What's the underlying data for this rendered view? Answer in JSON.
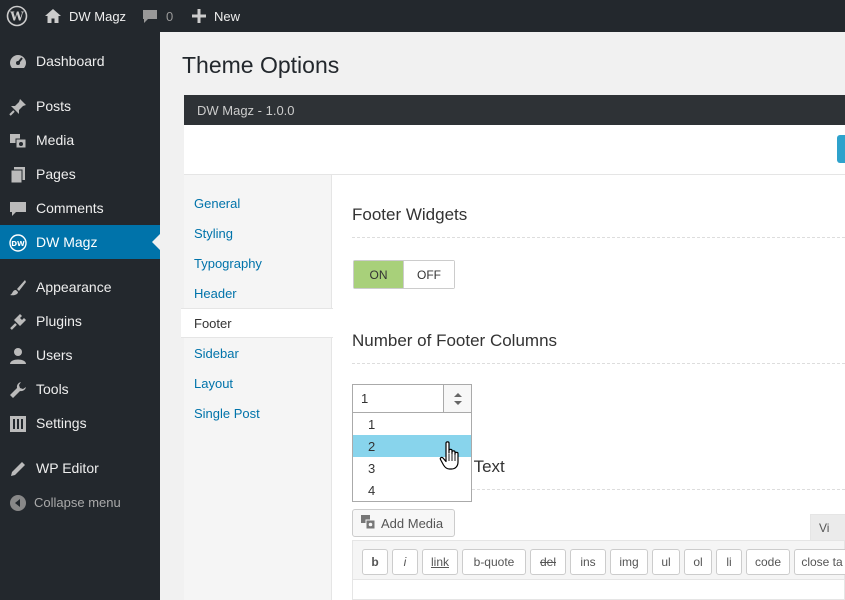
{
  "admin_bar": {
    "site_name": "DW Magz",
    "comments_count": "0",
    "new_label": "New"
  },
  "sidebar": {
    "items": [
      {
        "label": "Dashboard",
        "icon": "dashboard-icon"
      },
      {
        "label": "Posts",
        "icon": "pin-icon"
      },
      {
        "label": "Media",
        "icon": "media-icon"
      },
      {
        "label": "Pages",
        "icon": "pages-icon"
      },
      {
        "label": "Comments",
        "icon": "comment-icon"
      },
      {
        "label": "DW Magz",
        "icon": "dw-logo-icon",
        "active": true
      },
      {
        "label": "Appearance",
        "icon": "brush-icon"
      },
      {
        "label": "Plugins",
        "icon": "plug-icon"
      },
      {
        "label": "Users",
        "icon": "user-icon"
      },
      {
        "label": "Tools",
        "icon": "wrench-icon"
      },
      {
        "label": "Settings",
        "icon": "settings-icon"
      },
      {
        "label": "WP Editor",
        "icon": "pencil-icon"
      }
    ],
    "collapse_label": "Collapse menu"
  },
  "page": {
    "title": "Theme Options"
  },
  "panel": {
    "header": "DW Magz - 1.0.0",
    "tabs": [
      "General",
      "Styling",
      "Typography",
      "Header",
      "Footer",
      "Sidebar",
      "Layout",
      "Single Post"
    ],
    "active_tab": "Footer"
  },
  "footer_options": {
    "widgets_title": "Footer Widgets",
    "toggle_on": "ON",
    "toggle_off": "OFF",
    "toggle_state": "ON",
    "columns_title": "Number of Footer Columns",
    "columns_value": "1",
    "columns_options": [
      "1",
      "2",
      "3",
      "4"
    ],
    "highlighted_option": "2",
    "copyright_title_visible": "nt Text",
    "add_media_label": "Add Media",
    "visual_tab_label": "Vi"
  },
  "quicktags": [
    "b",
    "i",
    "link",
    "b-quote",
    "del",
    "ins",
    "img",
    "ul",
    "ol",
    "li",
    "code",
    "close ta"
  ],
  "colors": {
    "admin_dark": "#23282d",
    "active_blue": "#0073aa",
    "toggle_green": "#a8d07a",
    "highlight_blue": "#88d4ec"
  }
}
